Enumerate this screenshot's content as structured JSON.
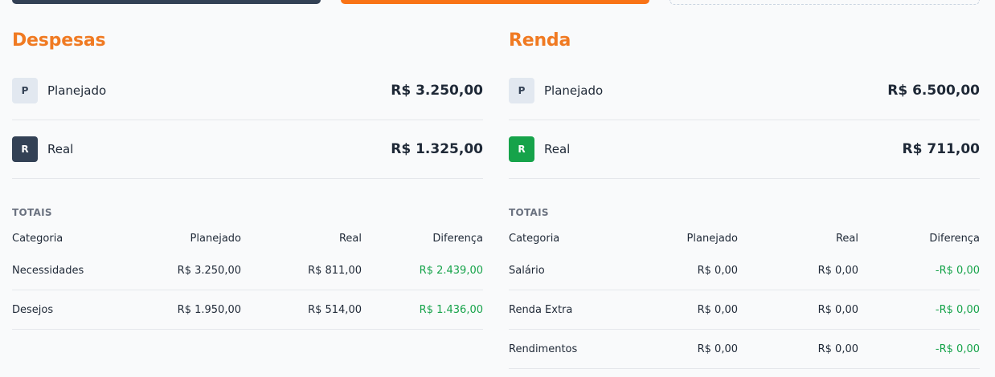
{
  "colors": {
    "accent": "#f07a22",
    "positive": "#16a34a",
    "dark": "#334155"
  },
  "expenses": {
    "title": "Despesas",
    "planned": {
      "badge": "P",
      "label": "Planejado",
      "value": "R$ 3.250,00"
    },
    "actual": {
      "badge": "R",
      "label": "Real",
      "value": "R$ 1.325,00"
    },
    "totals_label": "TOTAIS",
    "columns": [
      "Categoria",
      "Planejado",
      "Real",
      "Diferença"
    ],
    "rows": [
      [
        "Necessidades",
        "R$ 3.250,00",
        "R$ 811,00",
        "R$ 2.439,00"
      ],
      [
        "Desejos",
        "R$ 1.950,00",
        "R$ 514,00",
        "R$ 1.436,00"
      ]
    ]
  },
  "income": {
    "title": "Renda",
    "planned": {
      "badge": "P",
      "label": "Planejado",
      "value": "R$ 6.500,00"
    },
    "actual": {
      "badge": "R",
      "label": "Real",
      "value": "R$ 711,00"
    },
    "totals_label": "TOTAIS",
    "columns": [
      "Categoria",
      "Planejado",
      "Real",
      "Diferença"
    ],
    "rows": [
      [
        "Salário",
        "R$ 0,00",
        "R$ 0,00",
        "-R$ 0,00"
      ],
      [
        "Renda Extra",
        "R$ 0,00",
        "R$ 0,00",
        "-R$ 0,00"
      ],
      [
        "Rendimentos",
        "R$ 0,00",
        "R$ 0,00",
        "-R$ 0,00"
      ]
    ]
  }
}
